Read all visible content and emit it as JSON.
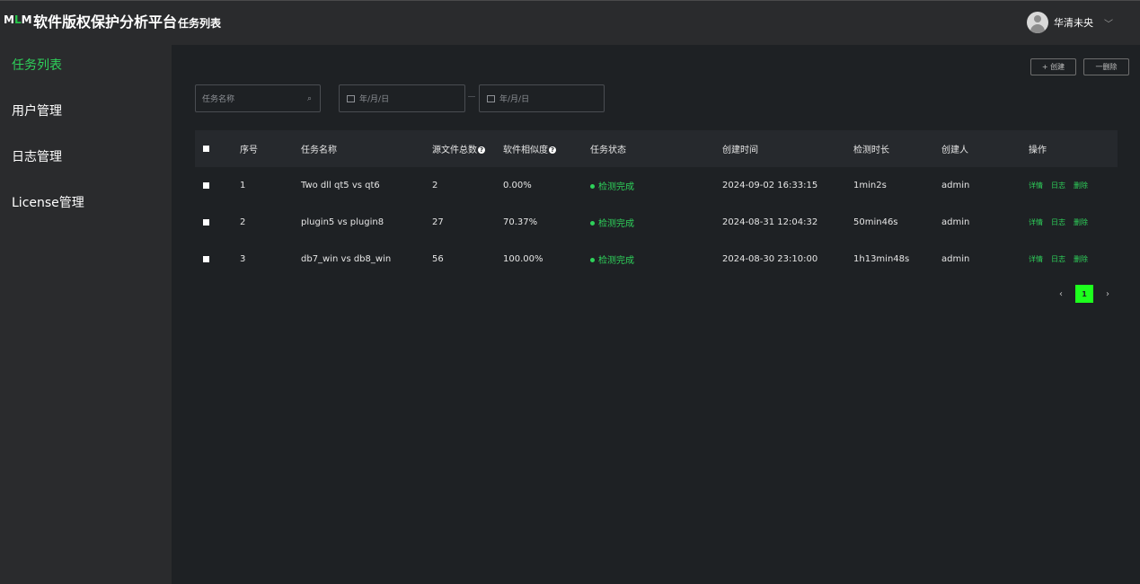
{
  "app": {
    "logo_left": "M",
    "logo_mid": "L",
    "logo_right": "M",
    "title": "软件版权保护分析平台"
  },
  "header": {
    "page_title": "任务列表",
    "user_name": "华清未央",
    "chevron": "﹀"
  },
  "sidebar": {
    "items": [
      {
        "label": "任务列表",
        "active": true
      },
      {
        "label": "用户管理",
        "active": false
      },
      {
        "label": "日志管理",
        "active": false
      },
      {
        "label": "License管理",
        "active": false
      }
    ]
  },
  "toolbar": {
    "create_label": "+ 创建",
    "delete_label": "一删除"
  },
  "filters": {
    "task_name_placeholder": "任务名称",
    "search_icon": "⌕",
    "start_date_placeholder": "年/月/日",
    "end_date_placeholder": "年/月/日"
  },
  "table": {
    "headers": {
      "index": "序号",
      "name": "任务名称",
      "file_count": "源文件总数",
      "similarity": "软件相似度",
      "status": "任务状态",
      "created_at": "创建时间",
      "duration": "检测时长",
      "creator": "创建人",
      "actions": "操作"
    },
    "help_glyph": "?",
    "rows": [
      {
        "index": "1",
        "name": "Two dll qt5 vs qt6",
        "file_count": "2",
        "similarity": "0.00%",
        "status": "检测完成",
        "created_at": "2024-09-02 16:33:15",
        "duration": "1min2s",
        "creator": "admin"
      },
      {
        "index": "2",
        "name": "plugin5 vs plugin8",
        "file_count": "27",
        "similarity": "70.37%",
        "status": "检测完成",
        "created_at": "2024-08-31 12:04:32",
        "duration": "50min46s",
        "creator": "admin"
      },
      {
        "index": "3",
        "name": "db7_win vs db8_win",
        "file_count": "56",
        "similarity": "100.00%",
        "status": "检测完成",
        "created_at": "2024-08-30 23:10:00",
        "duration": "1h13min48s",
        "creator": "admin"
      }
    ],
    "actions": {
      "detail": "详情",
      "log": "日志",
      "delete": "删除"
    }
  },
  "pagination": {
    "prev": "‹",
    "current": "1",
    "next": "›"
  },
  "colors": {
    "accent": "#2ed15a",
    "pager_active": "#1dff1d",
    "background": "#1e2124",
    "panel": "#2a2b2d"
  }
}
